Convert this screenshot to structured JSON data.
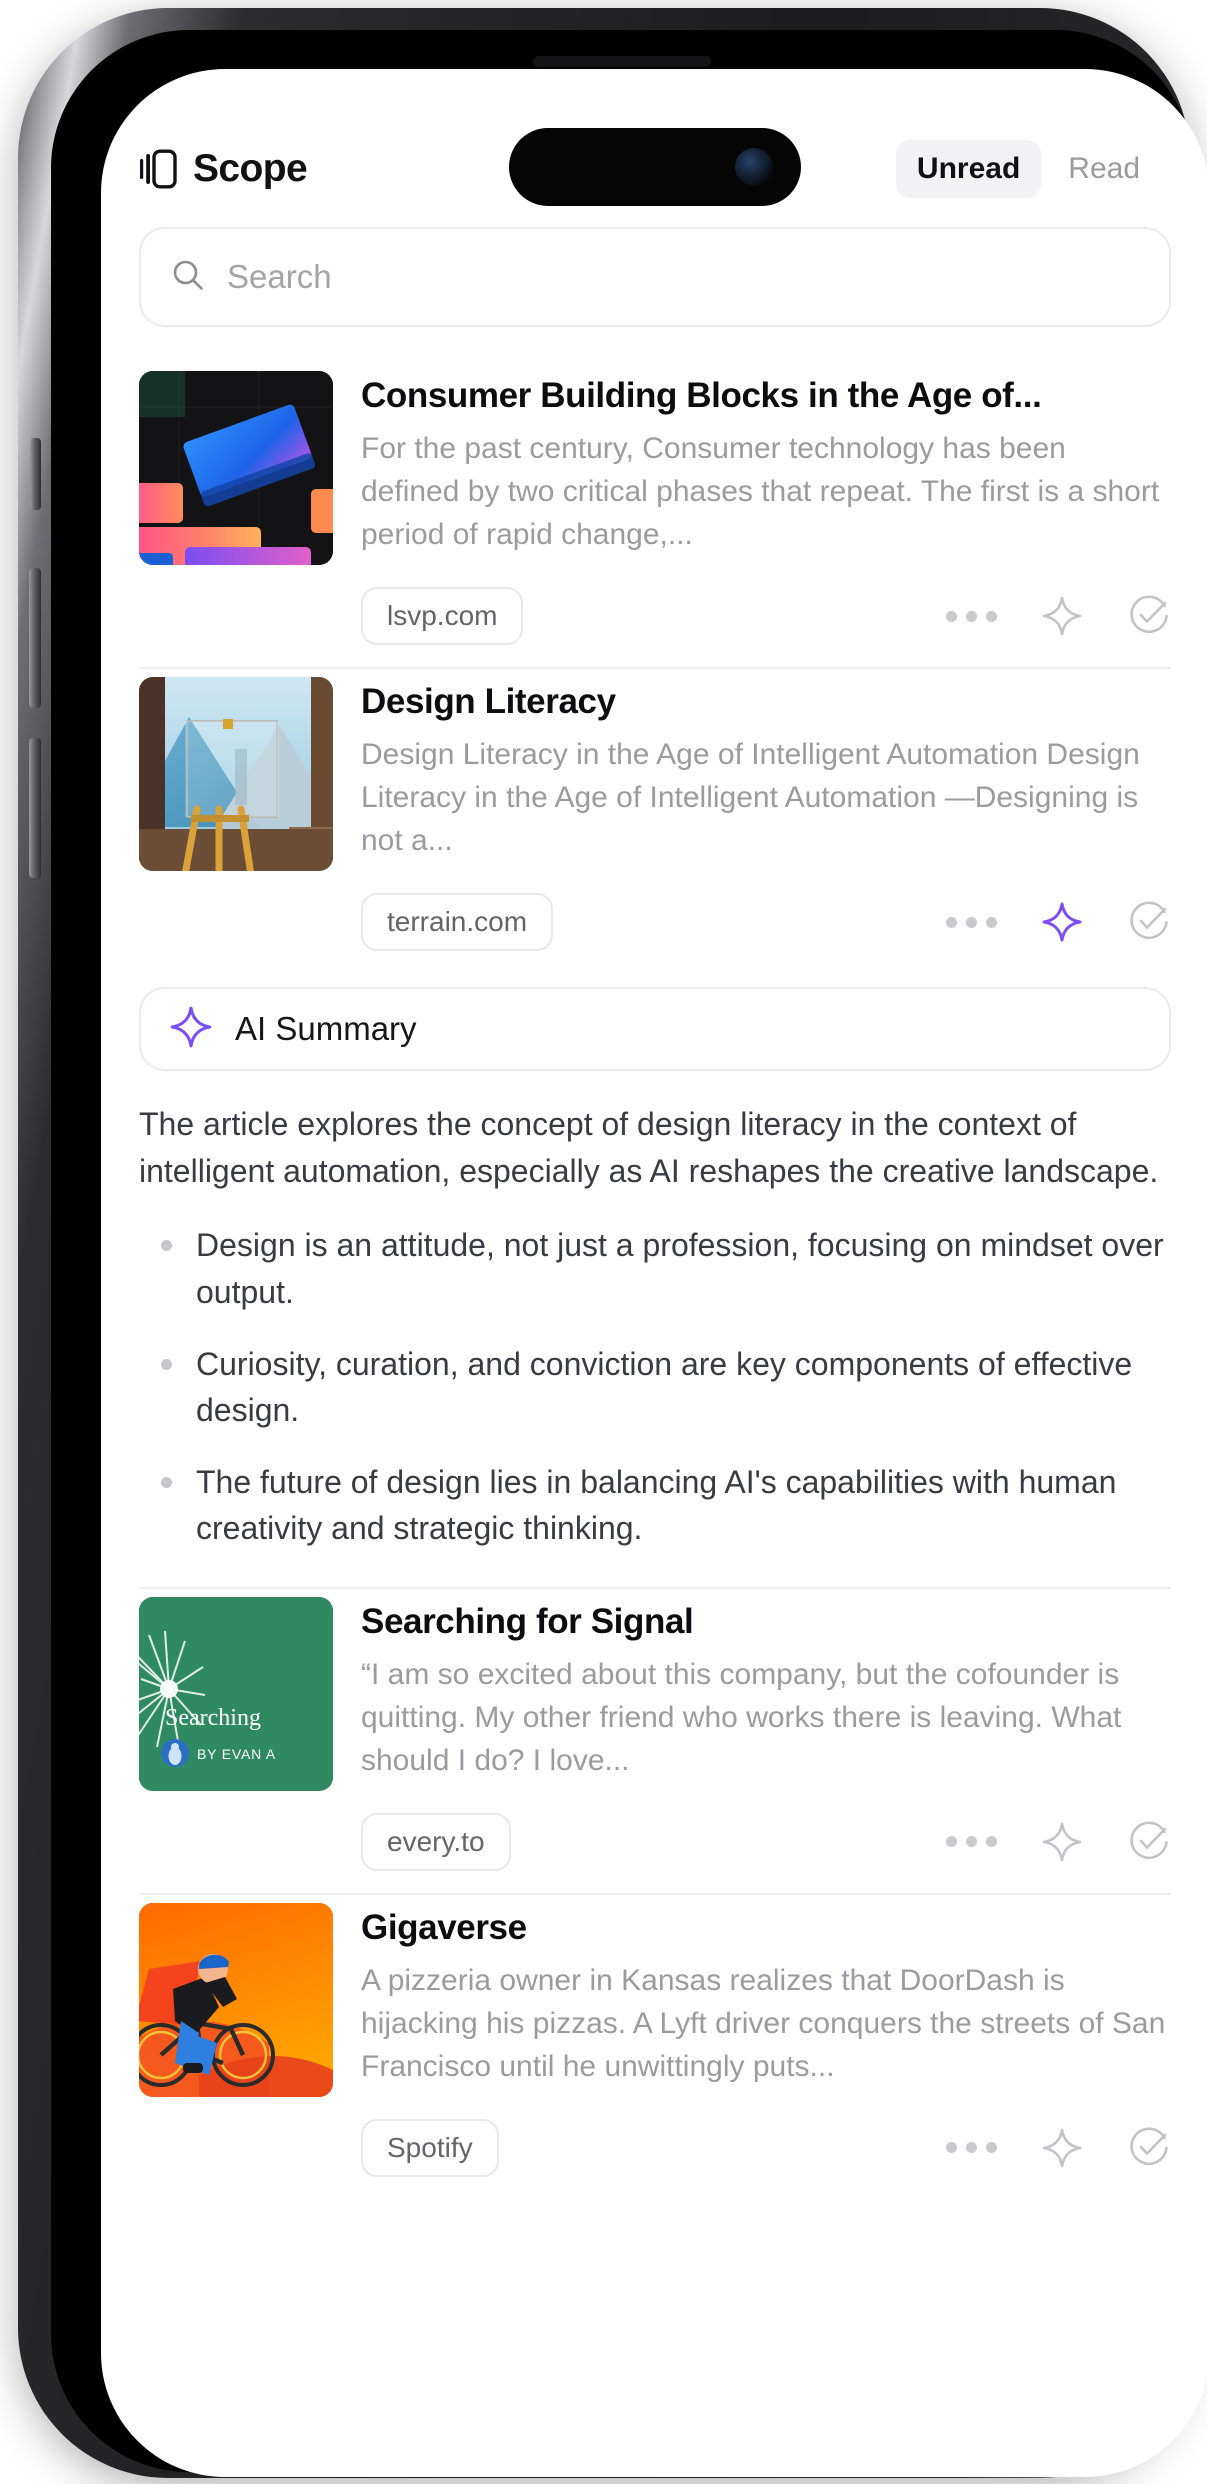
{
  "header": {
    "brand_icon": "scope-logo-icon",
    "brand_name": "Scope",
    "tabs": [
      {
        "label": "Unread",
        "active": true
      },
      {
        "label": "Read",
        "active": false
      }
    ]
  },
  "search": {
    "icon": "search-icon",
    "placeholder": "Search",
    "value": ""
  },
  "colors": {
    "accent_purple": "#7B4DF2",
    "text_primary": "#0D0D0F",
    "text_secondary": "#9B9B9F",
    "chip_border": "#E9E9EC",
    "divider": "#EEEEF0",
    "tab_active_bg": "#F2F2F4"
  },
  "action_icons": {
    "more": "more-horizontal-icon",
    "summarize": "sparkle-icon",
    "mark_read": "check-circle-icon"
  },
  "articles": [
    {
      "title": "Consumer Building Blocks in the Age of...",
      "snippet": "For the past century, Consumer technology has been defined by two critical phases that repeat. The first is a short period of rapid change,...",
      "domain": "lsvp.com",
      "thumbnail": "dark-gradient-blocks-thumbnail",
      "sparkle_active": false
    },
    {
      "title": "Design Literacy",
      "snippet": "Design Literacy in the Age of Intelligent Automation Design Literacy in the Age of Intelligent Automation —Designing is not a...",
      "domain": "terrain.com",
      "thumbnail": "easel-mountain-painting-thumbnail",
      "sparkle_active": true
    },
    {
      "title": "Searching for Signal",
      "snippet": "“I am so excited about this company, but the cofounder is quitting. My other friend who works there is leaving. What should I do? I love...",
      "domain": "every.to",
      "thumbnail": "green-searching-for-signal-cover",
      "thumbnail_text": "Searching",
      "thumbnail_byline": "BY EVAN A",
      "sparkle_active": false
    },
    {
      "title": "Gigaverse",
      "snippet": "A pizzeria owner in Kansas realizes that DoorDash is hijacking his pizzas. A Lyft driver conquers the streets of San Francisco until he unwittingly puts...",
      "domain": "Spotify",
      "thumbnail": "orange-cyclist-illustration-thumbnail",
      "sparkle_active": false
    }
  ],
  "ai_summary": {
    "icon": "sparkle-icon",
    "label": "AI Summary",
    "intro": "The article explores the concept of design literacy in the context of intelligent automation, especially as AI reshapes the creative landscape.",
    "bullets": [
      "Design is an attitude, not just a profession, focusing on mindset over output.",
      "Curiosity, curation, and conviction are key components of effective design.",
      "The future of design lies in balancing AI's capabilities with human creativity and strategic thinking."
    ]
  }
}
